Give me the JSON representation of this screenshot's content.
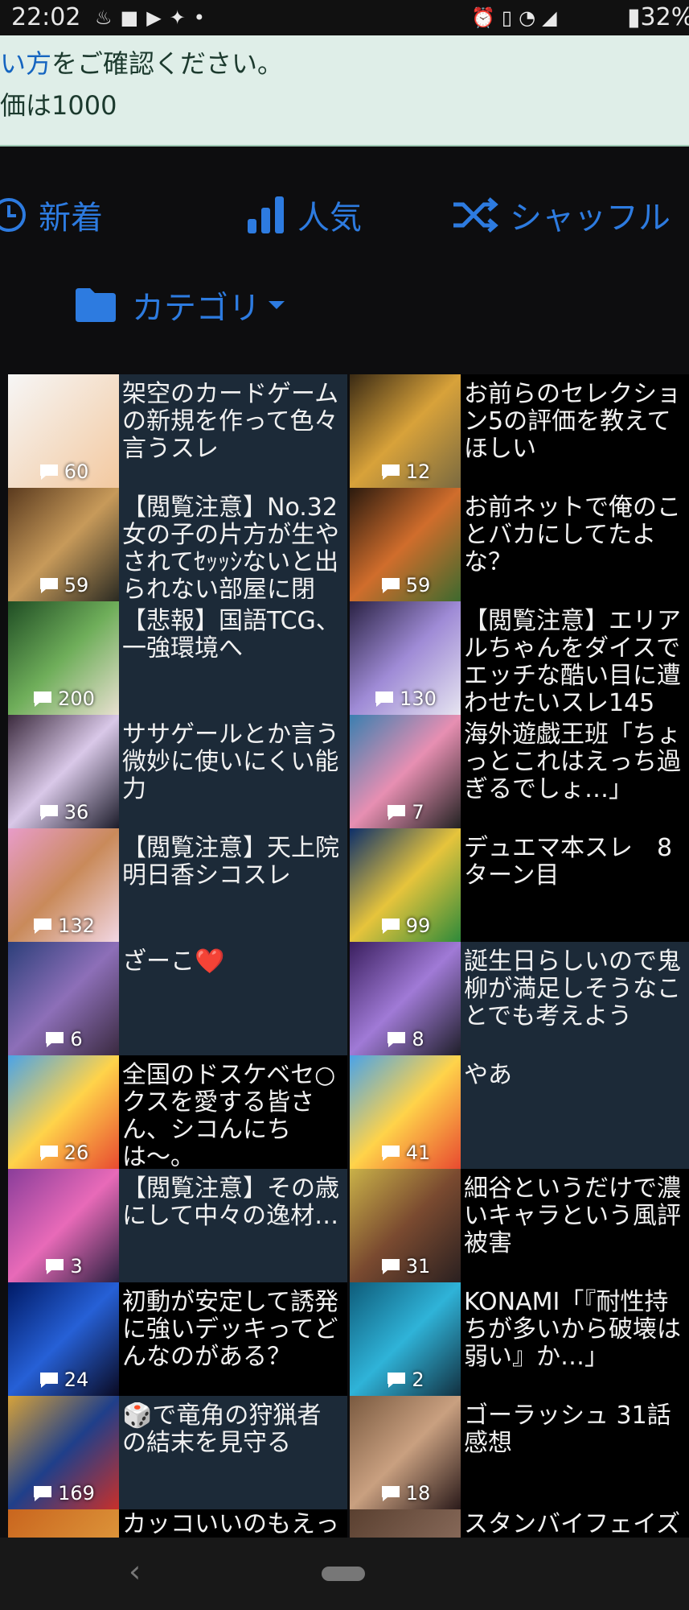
{
  "status": {
    "time": "22:02",
    "left_icons": [
      "notification-icon",
      "app-icon",
      "youtube-icon",
      "twitter-icon",
      "dot-icon"
    ],
    "right_icons": [
      "alarm-icon",
      "vibrate-icon",
      "wifi-icon",
      "signal-icon",
      "battery-icon"
    ],
    "battery": "32%"
  },
  "notice": {
    "line1_link": "い方",
    "line1_text": "をご確認ください。",
    "line2_text": "価は1000"
  },
  "nav": {
    "new_label": "新着",
    "popular_label": "人気",
    "shuffle_label": "シャッフル",
    "category_label": "カテゴリ",
    "accent": "#2d7be0"
  },
  "threads": [
    {
      "title": "架空のカードゲームの新規を作って色々言うスレ",
      "count": "60"
    },
    {
      "title": "お前らのセレクション5の評価を教えてほしい",
      "count": "12"
    },
    {
      "title": "【閲覧注意】No.32 女の子の片方が生やされてｾｯｯｼないと出られない部屋に閉",
      "count": "59"
    },
    {
      "title": "お前ネットで俺のことバカにしてたよな？",
      "count": "59"
    },
    {
      "title": "【悲報】国語TCG、一強環境へ",
      "count": "200"
    },
    {
      "title": "【閲覧注意】エリアルちゃんをダイスでエッチな酷い目に遭わせたいスレ145",
      "count": "130"
    },
    {
      "title": "ササゲールとか言う微妙に使いにくい能力",
      "count": "36"
    },
    {
      "title": "海外遊戯王班「ちょっとこれはえっち過ぎるでしょ…」",
      "count": "7"
    },
    {
      "title": "【閲覧注意】天上院明日香シコスレ",
      "count": "132"
    },
    {
      "title": "デュエマ本スレ　8ターン目",
      "count": "99"
    },
    {
      "title": "ざーこ❤️",
      "count": "6"
    },
    {
      "title": "誕生日らしいので鬼柳が満足しそうなことでも考えよう",
      "count": "8"
    },
    {
      "title": "全国のドスケベセ○クスを愛する皆さん、シコんにちは〜。",
      "count": "26"
    },
    {
      "title": "やあ",
      "count": "41"
    },
    {
      "title": "【閲覧注意】その歳にして中々の逸材…",
      "count": "3"
    },
    {
      "title": "細谷というだけで濃いキャラという風評被害",
      "count": "31"
    },
    {
      "title": "初動が安定して誘発に強いデッキってどんなのがある？",
      "count": "24"
    },
    {
      "title": "KONAMI「『耐性持ちが多いから破壊は弱い』か…」",
      "count": "2"
    },
    {
      "title": "🎲で竜角の狩猟者の結末を見守る",
      "count": "169"
    },
    {
      "title": "ゴーラッシュ 31話感想",
      "count": "18"
    }
  ],
  "partial_threads": [
    {
      "title": "カッコいいのもえっ"
    },
    {
      "title": "スタンバイフェイズ"
    }
  ]
}
